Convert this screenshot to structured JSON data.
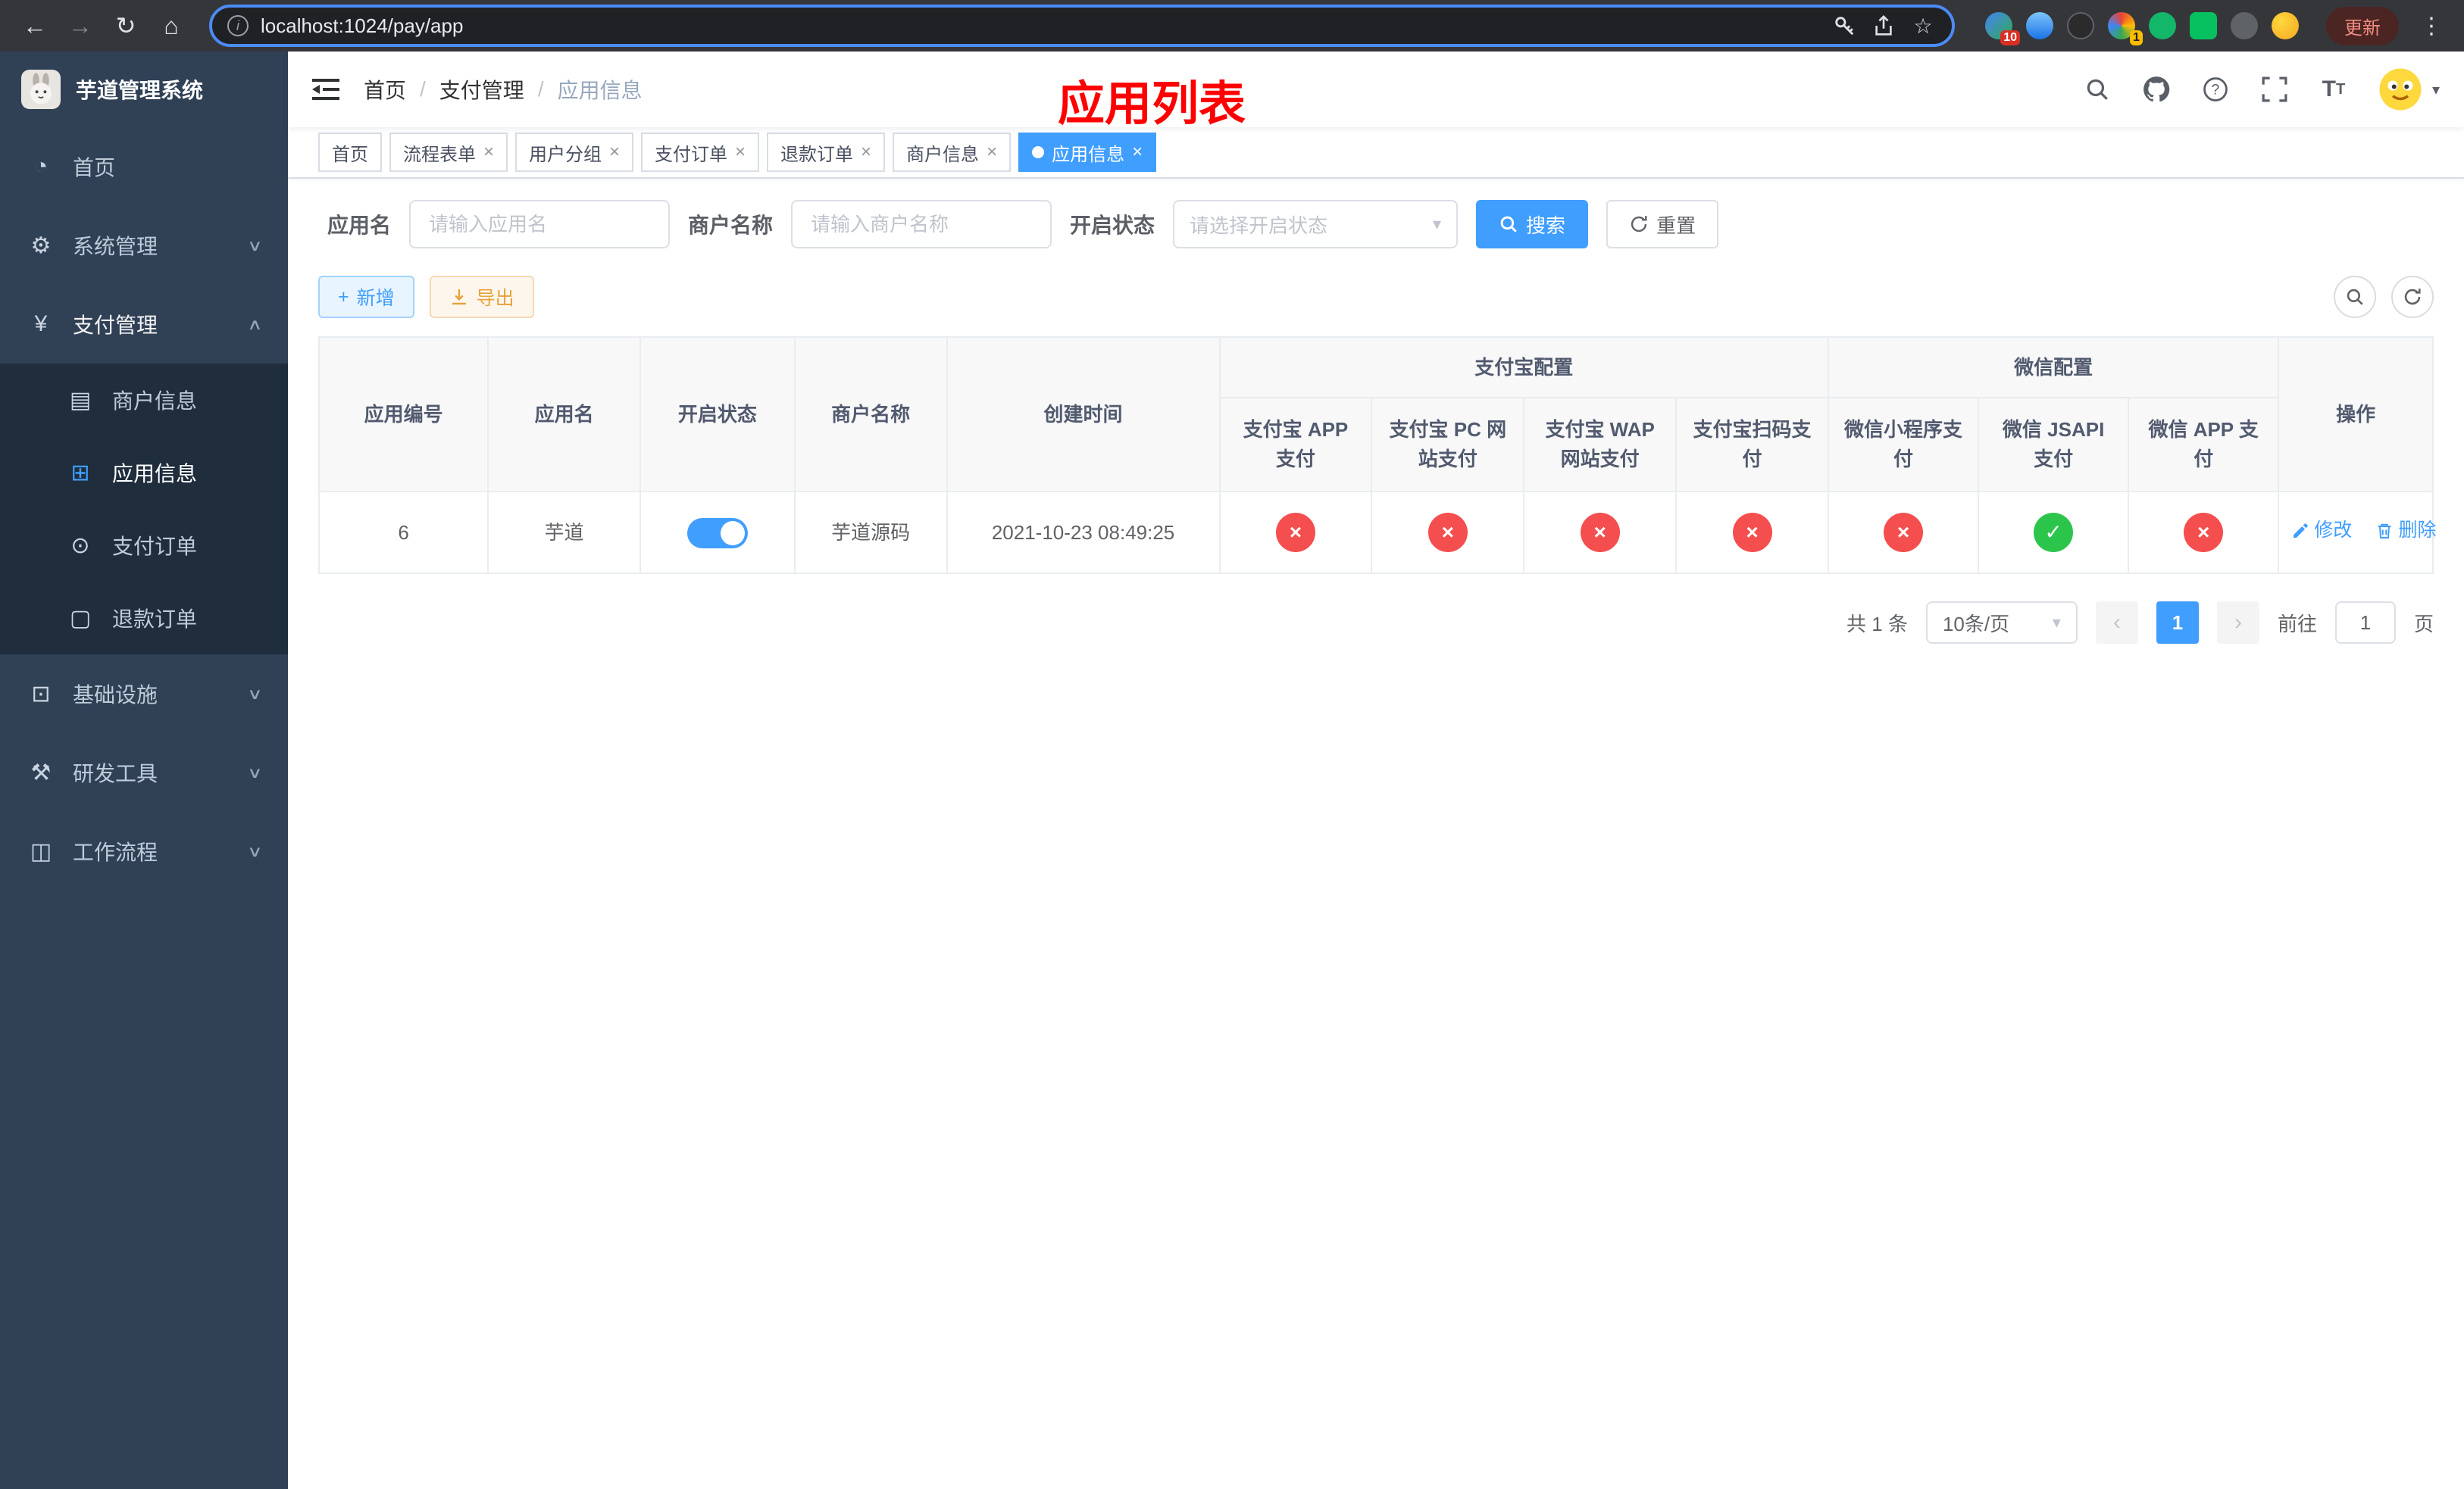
{
  "colors": {
    "primary": "#409eff",
    "danger": "#f54e4e",
    "success": "#2cc54c",
    "warning": "#e6a23c",
    "annotation": "#fe0000"
  },
  "browser": {
    "url": "localhost:1024/pay/app",
    "update_label": "更新",
    "extension_badge_1": "10",
    "extension_badge_2": "1"
  },
  "sidebar": {
    "logo_title": "芋道管理系统",
    "items": [
      {
        "label": "首页"
      },
      {
        "label": "系统管理"
      },
      {
        "label": "支付管理",
        "children": [
          {
            "label": "商户信息"
          },
          {
            "label": "应用信息"
          },
          {
            "label": "支付订单"
          },
          {
            "label": "退款订单"
          }
        ]
      },
      {
        "label": "基础设施"
      },
      {
        "label": "研发工具"
      },
      {
        "label": "工作流程"
      }
    ]
  },
  "header": {
    "breadcrumb": [
      "首页",
      "支付管理",
      "应用信息"
    ],
    "annotation": "应用列表"
  },
  "tabs": [
    {
      "label": "首页"
    },
    {
      "label": "流程表单"
    },
    {
      "label": "用户分组"
    },
    {
      "label": "支付订单"
    },
    {
      "label": "退款订单"
    },
    {
      "label": "商户信息"
    },
    {
      "label": "应用信息"
    }
  ],
  "filters": {
    "app_name_label": "应用名",
    "app_name_placeholder": "请输入应用名",
    "merchant_label": "商户名称",
    "merchant_placeholder": "请输入商户名称",
    "status_label": "开启状态",
    "status_placeholder": "请选择开启状态",
    "search_label": "搜索",
    "reset_label": "重置"
  },
  "toolbar": {
    "add_label": "新增",
    "export_label": "导出"
  },
  "table": {
    "columns": {
      "app_id": "应用编号",
      "app_name": "应用名",
      "status": "开启状态",
      "merchant": "商户名称",
      "created": "创建时间",
      "alipay_group": "支付宝配置",
      "alipay_subs": [
        "支付宝 APP 支付",
        "支付宝 PC 网站支付",
        "支付宝 WAP 网站支付",
        "支付宝扫码支付"
      ],
      "wechat_group": "微信配置",
      "wechat_subs": [
        "微信小程序支付",
        "微信 JSAPI 支付",
        "微信 APP 支付"
      ],
      "actions": "操作"
    },
    "row": {
      "app_id": "6",
      "app_name": "芋道",
      "enabled": true,
      "merchant": "芋道源码",
      "created": "2021-10-23 08:49:25",
      "alipay": [
        false,
        false,
        false,
        false
      ],
      "wechat": [
        false,
        true,
        false
      ],
      "edit_label": "修改",
      "delete_label": "删除"
    }
  },
  "pagination": {
    "total": "共 1 条",
    "page_size": "10条/页",
    "current_page": "1",
    "goto_prefix": "前往",
    "goto_value": "1",
    "goto_suffix": "页"
  }
}
